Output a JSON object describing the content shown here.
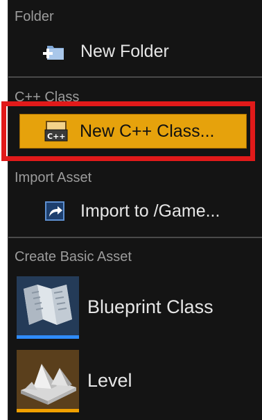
{
  "sections": {
    "folder": {
      "header": "Folder",
      "new_folder_label": "New Folder"
    },
    "cpp_class": {
      "header": "C++ Class",
      "new_cpp_class_label": "New C++ Class..."
    },
    "import_asset": {
      "header": "Import Asset",
      "import_label": "Import to /Game..."
    },
    "create_basic_asset": {
      "header": "Create Basic Asset",
      "items": [
        {
          "label": "Blueprint Class",
          "icon": "blueprint-class-icon",
          "accent": "#2f8cff"
        },
        {
          "label": "Level",
          "icon": "level-icon",
          "accent": "#f0a000"
        }
      ]
    }
  },
  "colors": {
    "menu_bg": "#141414",
    "header_text": "#9c9c9c",
    "item_text": "#e6e6e6",
    "selected_bg": "#e6a20c",
    "highlight_outline": "#e11a1a"
  }
}
